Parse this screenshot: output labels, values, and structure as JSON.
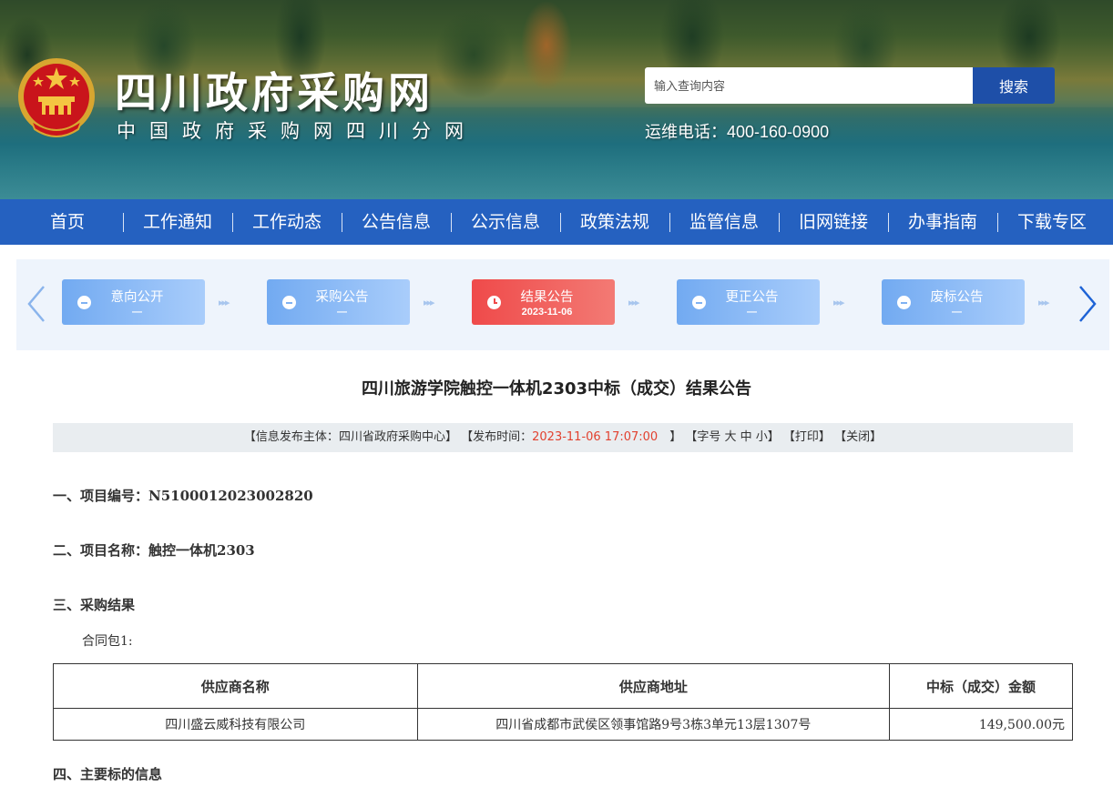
{
  "header": {
    "site_title": "四川政府采购网",
    "site_subtitle": "中国政府采购网四川分网",
    "search_placeholder": "输入查询内容",
    "search_button": "搜索",
    "hotline": "运维电话：400-160-0900"
  },
  "nav": {
    "items": [
      "首页",
      "工作通知",
      "工作动态",
      "公告信息",
      "公示信息",
      "政策法规",
      "监管信息",
      "旧网链接",
      "办事指南",
      "下载专区"
    ]
  },
  "steps": [
    {
      "label": "意向公开",
      "date": "—",
      "active": false
    },
    {
      "label": "采购公告",
      "date": "—",
      "active": false
    },
    {
      "label": "结果公告",
      "date": "2023-11-06",
      "active": true
    },
    {
      "label": "更正公告",
      "date": "—",
      "active": false
    },
    {
      "label": "废标公告",
      "date": "—",
      "active": false
    }
  ],
  "document": {
    "title": "四川旅游学院触控一体机2303中标（成交）结果公告",
    "meta": {
      "publisher_prefix": "【信息发布主体：",
      "publisher": "四川省政府采购中心",
      "publisher_suffix": "】",
      "time_prefix": "【发布时间：",
      "time": "2023-11-06 17:07:00",
      "time_suffix": "　】",
      "font_size": "【字号 大 中 小】",
      "print": "【打印】",
      "close": "【关闭】"
    },
    "section1": "一、项目编号：N5100012023002820",
    "section2": "二、项目名称：触控一体机2303",
    "section3": "三、采购结果",
    "package": "合同包1:",
    "table": {
      "headers": [
        "供应商名称",
        "供应商地址",
        "中标（成交）金额"
      ],
      "rows": [
        [
          "四川盛云威科技有限公司",
          "四川省成都市武侯区领事馆路9号3栋3单元13层1307号",
          "149,500.00元"
        ]
      ]
    },
    "section4": "四、主要标的信息"
  },
  "colors": {
    "nav_bg": "#2561c0",
    "search_button": "#1e4fa8",
    "step_active": "#ef4a4a",
    "step_inactive": "#72aaf1",
    "highlight_time": "#e2412f"
  }
}
